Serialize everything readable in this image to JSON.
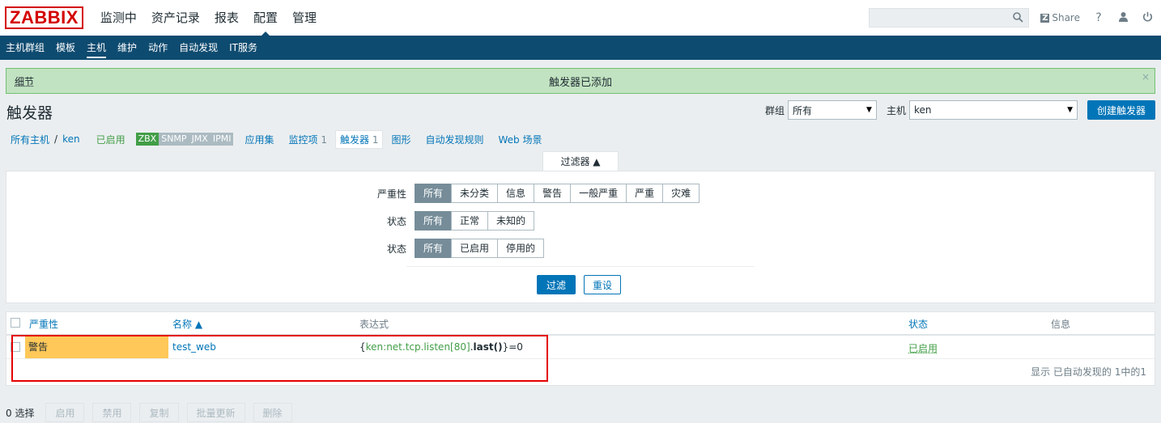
{
  "header": {
    "logo": "ZABBIX",
    "menu": [
      "监测中",
      "资产记录",
      "报表",
      "配置",
      "管理"
    ],
    "search_placeholder": "",
    "share_label": "Share",
    "help_label": "?"
  },
  "subnav": [
    "主机群组",
    "模板",
    "主机",
    "维护",
    "动作",
    "自动发现",
    "IT服务"
  ],
  "message": {
    "details": "细节",
    "text": "触发器已添加",
    "close": "×"
  },
  "page": {
    "title": "触发器",
    "group_label": "群组",
    "group_value": "所有",
    "host_label": "主机",
    "host_value": "ken",
    "create_button": "创建触发器"
  },
  "host_nav": {
    "all_hosts": "所有主机",
    "separator": "/",
    "host": "ken",
    "status": "已启用",
    "tags": [
      "ZBX",
      "SNMP",
      "JMX",
      "IPMI"
    ],
    "applications": "应用集",
    "items": "监控项",
    "items_count": "1",
    "triggers": "触发器",
    "triggers_count": "1",
    "graphs": "图形",
    "discovery": "自动发现规则",
    "web": "Web 场景"
  },
  "filter": {
    "tab_label": "过滤器 ▲",
    "severity_label": "严重性",
    "severity_options": [
      "所有",
      "未分类",
      "信息",
      "警告",
      "一般严重",
      "严重",
      "灾难"
    ],
    "state_label": "状态",
    "state_options": [
      "所有",
      "正常",
      "未知的"
    ],
    "status_label": "状态",
    "status_options": [
      "所有",
      "已启用",
      "停用的"
    ],
    "apply_button": "过滤",
    "reset_button": "重设"
  },
  "table": {
    "columns": {
      "severity": "严重性",
      "name": "名称 ▲",
      "expression": "表达式",
      "status": "状态",
      "info": "信息"
    },
    "rows": [
      {
        "severity": "警告",
        "name": "test_web",
        "expr_open": "{",
        "expr_key": "ken:net.tcp.listen[80]",
        "expr_dot": ".",
        "expr_fn": "last()",
        "expr_close": "}=0",
        "status": "已启用"
      }
    ],
    "footer": "显示 已自动发现的 1中的1"
  },
  "actions": {
    "selected": "0 选择",
    "buttons": [
      "启用",
      "禁用",
      "复制",
      "批量更新",
      "删除"
    ]
  },
  "colors": {
    "brand_red": "#d40000",
    "nav_blue": "#0e4b70",
    "link_blue": "#0275b8",
    "warning_yellow": "#ffc859",
    "enabled_green": "#429e47",
    "success_bg": "#c2e3c1"
  }
}
